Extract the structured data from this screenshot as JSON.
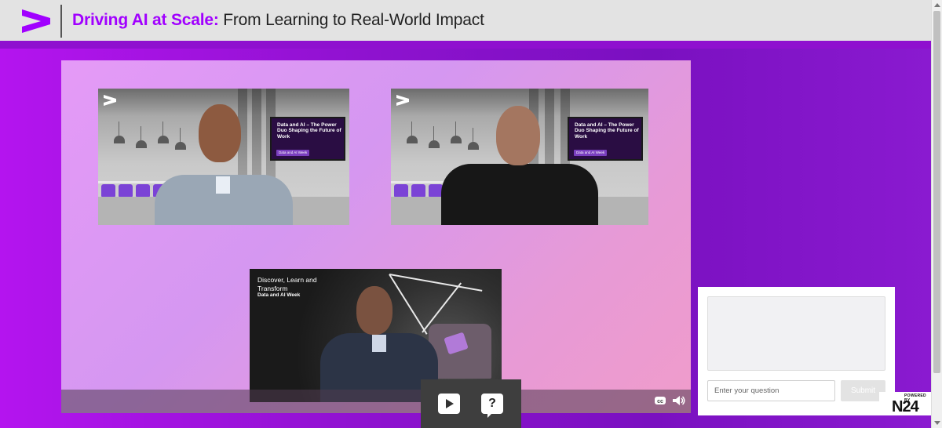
{
  "header": {
    "title_accent": "Driving AI at Scale:",
    "title_rest": " From Learning to Real-World Impact"
  },
  "colors": {
    "brand_purple": "#a100ff",
    "background_purple": "#8a14c8",
    "header_bg": "#e3e3e3"
  },
  "player": {
    "tiles": [
      {
        "screen_title": "Data and AI – The Power Duo Shaping the Future of Work",
        "screen_chip": "Data and AI Week"
      },
      {
        "screen_title": "Data and AI – The Power Duo Shaping the Future of Work",
        "screen_chip": "Data and AI Week"
      },
      {
        "caption_line1": "Discover, Learn and",
        "caption_line2": "Transform",
        "caption_sub": "Data and AI Week"
      }
    ],
    "controls": {
      "cc_icon": "closed-captions-icon",
      "volume_icon": "volume-icon"
    }
  },
  "overlay": {
    "play_icon": "play-icon",
    "help_symbol": "?"
  },
  "qa": {
    "input_placeholder": "Enter your question",
    "submit_label": "Submit"
  },
  "badge": {
    "powered_by": "POWERED BY",
    "brand": "N24"
  }
}
